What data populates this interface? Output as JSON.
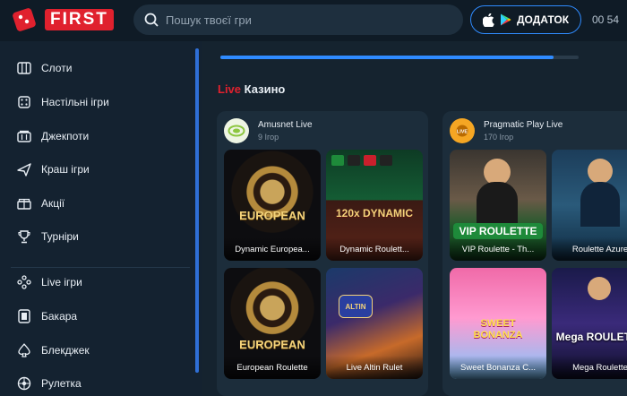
{
  "header": {
    "brand": "FIRST",
    "search_placeholder": "Пошук твоєї гри",
    "app_button_label": "ДОДАТОК",
    "clock": "00 54"
  },
  "sidebar": {
    "items": [
      {
        "label": "Слоти",
        "icon": "slot-icon"
      },
      {
        "label": "Настільні ігри",
        "icon": "dice-icon"
      },
      {
        "label": "Джекпоти",
        "icon": "jackpot-icon"
      },
      {
        "label": "Краш ігри",
        "icon": "plane-icon"
      },
      {
        "label": "Акції",
        "icon": "promo-icon"
      },
      {
        "label": "Турніри",
        "icon": "trophy-icon"
      },
      {
        "label": "Live ігри",
        "icon": "live-icon"
      },
      {
        "label": "Бакара",
        "icon": "baccarat-icon"
      },
      {
        "label": "Блекджек",
        "icon": "spade-icon"
      },
      {
        "label": "Рулетка",
        "icon": "roulette-icon"
      }
    ]
  },
  "main": {
    "progress_fraction": 0.93,
    "section_title_live": "Live",
    "section_title_rest": "Казино",
    "providers": [
      {
        "name": "Amusnet Live",
        "count": "9 Ігор",
        "accent": "#8cc63f",
        "games": [
          "Dynamic Europea...",
          "Dynamic Roulett...",
          "European Roulette",
          "Live Altin Rulet"
        ],
        "art_text": [
          "EUROPEAN",
          "120x DYNAMIC",
          "EUROPEAN",
          "ALTIN"
        ]
      },
      {
        "name": "Pragmatic Play Live",
        "count": "170 Ігор",
        "accent": "#f5a623",
        "games": [
          "VIP Roulette - Th...",
          "Roulette Azure",
          "Sweet Bonanza C...",
          "Mega Roulette"
        ],
        "art_text": [
          "VIP ROULETTE",
          "",
          "SWEET BONANZA",
          "Mega ROULETTE"
        ]
      }
    ]
  },
  "colors": {
    "brand_red": "#e0212e",
    "accent_blue": "#2f8bff",
    "background": "#142230"
  }
}
